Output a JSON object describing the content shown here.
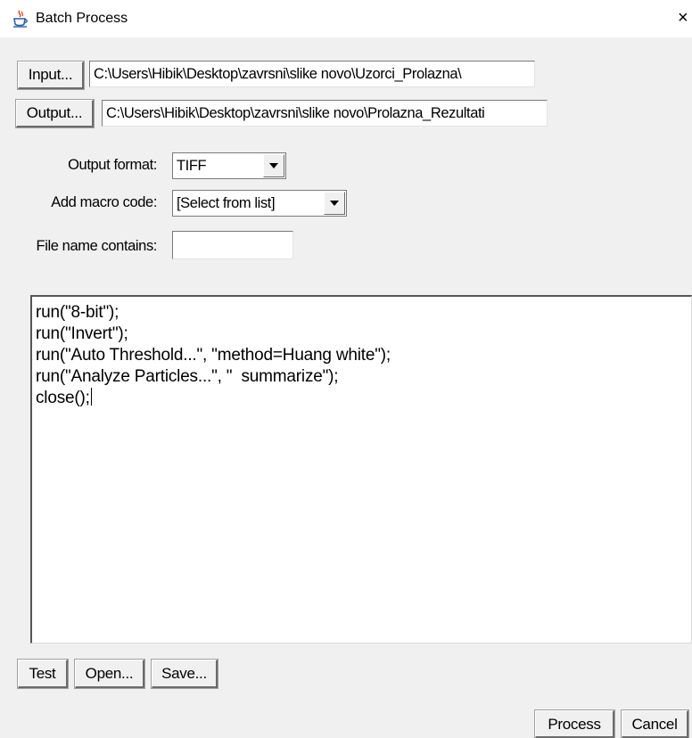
{
  "window": {
    "title": "Batch Process",
    "close_glyph": "×"
  },
  "input": {
    "button_label": "Input...",
    "path": "C:\\Users\\Hibik\\Desktop\\zavrsni\\slike novo\\Uzorci_Prolazna\\"
  },
  "output": {
    "button_label": "Output...",
    "path": "C:\\Users\\Hibik\\Desktop\\zavrsni\\slike novo\\Prolazna_Rezultati"
  },
  "options": {
    "output_format_label": "Output format:",
    "output_format_value": "TIFF",
    "macro_code_label": "Add macro code:",
    "macro_code_value": "[Select from list]",
    "file_name_label": "File name contains:",
    "file_name_value": ""
  },
  "macro": {
    "lines": [
      "run(\"8-bit\");",
      "run(\"Invert\");",
      "run(\"Auto Threshold...\", \"method=Huang white\");",
      "run(\"Analyze Particles...\", \"  summarize\");",
      "close();"
    ]
  },
  "buttons": {
    "test": "Test",
    "open": "Open...",
    "save": "Save...",
    "process": "Process",
    "cancel": "Cancel"
  },
  "icons": {
    "title": "java-cup-icon",
    "close": "close-icon"
  }
}
